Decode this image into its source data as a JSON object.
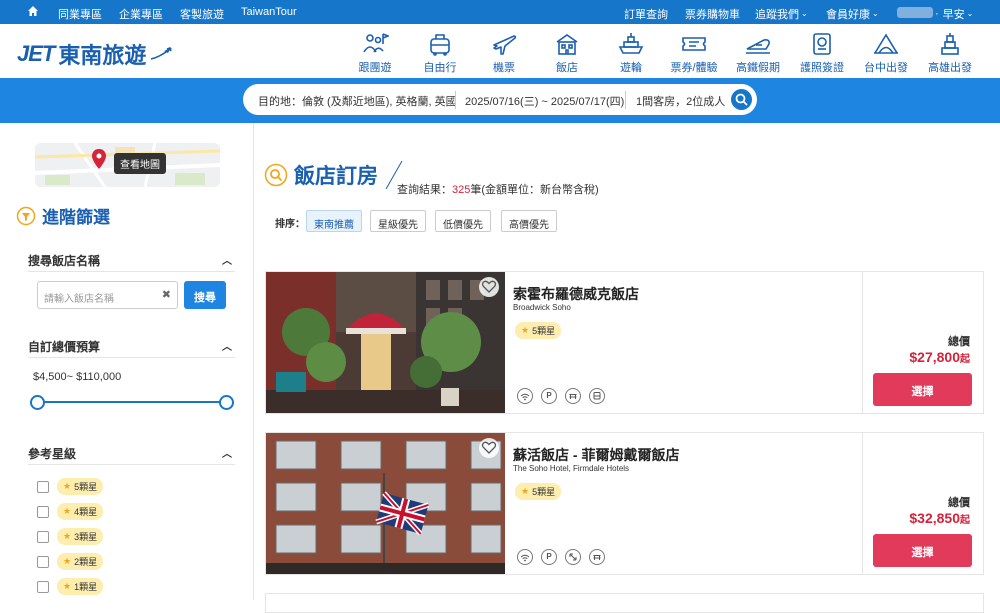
{
  "topbar": {
    "left_links": [
      "同業專區",
      "企業專區",
      "客製旅遊",
      "TaiwanTour"
    ],
    "right_links": [
      "訂單查詢",
      "票券購物車",
      "追蹤我們",
      "會員好康"
    ],
    "greeting": "早安"
  },
  "brand": {
    "logo_latin": "JET",
    "logo_chinese": "東南旅遊"
  },
  "nav": [
    {
      "label": "跟團遊",
      "icon": "tour-group-icon"
    },
    {
      "label": "自由行",
      "icon": "luggage-icon"
    },
    {
      "label": "機票",
      "icon": "airplane-icon"
    },
    {
      "label": "飯店",
      "icon": "hotel-icon"
    },
    {
      "label": "遊輪",
      "icon": "cruise-ship-icon"
    },
    {
      "label": "票券/體驗",
      "icon": "ticket-icon"
    },
    {
      "label": "高鐵假期",
      "icon": "high-speed-rail-icon"
    },
    {
      "label": "護照簽證",
      "icon": "passport-icon"
    },
    {
      "label": "台中出發",
      "icon": "taichung-landmark-icon"
    },
    {
      "label": "高雄出發",
      "icon": "kaohsiung-tower-icon"
    }
  ],
  "search": {
    "destination": "目的地：倫敦 (及鄰近地區), 英格蘭, 英國",
    "dates": "2025/07/16(三) ~ 2025/07/17(四)",
    "guests": "1間客房，2位成人"
  },
  "sidebar": {
    "map_button": "查看地圖",
    "advanced_filter": "進階篩選",
    "hotel_name_section": "搜尋飯店名稱",
    "hotel_name_placeholder": "請輸入飯店名稱",
    "hotel_search_button": "搜尋",
    "budget_section": "自訂總價預算",
    "budget_range": "$4,500~ $110,000",
    "budget_slider": {
      "min_fraction": 0,
      "max_fraction": 1
    },
    "star_section": "參考星級",
    "star_options": [
      "5顆星",
      "4顆星",
      "3顆星",
      "2顆星",
      "1顆星"
    ]
  },
  "main": {
    "title": "飯店訂房",
    "result_prefix": "查詢結果：",
    "result_count": "325",
    "result_suffix": "筆(金額單位：新台幣含稅)",
    "sort_label": "排序：",
    "sort_options": [
      "東南推薦",
      "星級優先",
      "低價優先",
      "高價優先"
    ],
    "active_sort": "東南推薦"
  },
  "hotels": [
    {
      "name": "索霍布羅德威克飯店",
      "name_en": "Broadwick Soho",
      "rating": "5顆星",
      "amenities": [
        "wifi-icon",
        "parking-icon",
        "restaurant-icon",
        "shuttle-bus-icon"
      ],
      "total_label": "總價",
      "price": "$27,800",
      "price_suffix": "起",
      "select_label": "選擇"
    },
    {
      "name": "蘇活飯店 - 菲爾姆戴爾飯店",
      "name_en": "The Soho Hotel, Firmdale Hotels",
      "rating": "5顆星",
      "amenities": [
        "wifi-icon",
        "parking-icon",
        "airport-transfer-icon",
        "restaurant-icon"
      ],
      "total_label": "總價",
      "price": "$32,850",
      "price_suffix": "起",
      "select_label": "選擇"
    }
  ],
  "colors": {
    "topbar": "#1676c9",
    "search_band": "#1e86e0",
    "brand_blue": "#1a5fb0",
    "price_red": "#d4233b",
    "select_button": "#e23a5b",
    "star_badge": "#fdeeb0"
  }
}
